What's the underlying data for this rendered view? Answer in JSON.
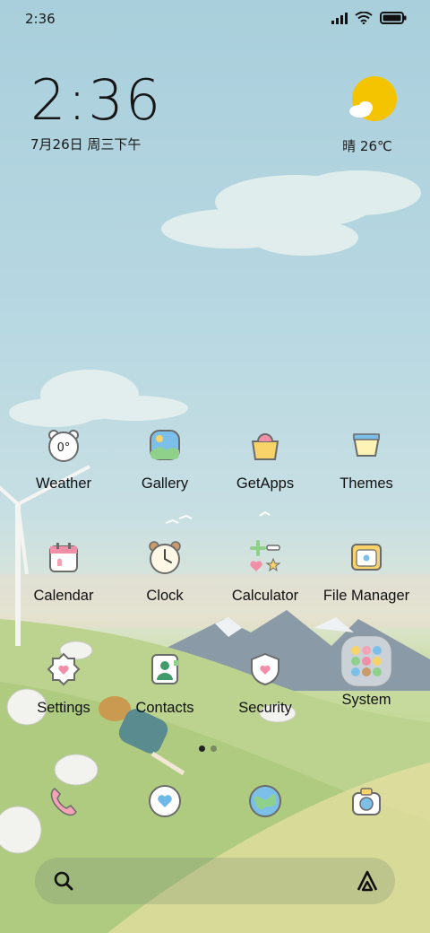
{
  "status_bar": {
    "time": "2:36",
    "icons": [
      "signal-icon",
      "wifi-icon",
      "battery-icon"
    ]
  },
  "clock_widget": {
    "time": "2:36",
    "date": "7月26日 周三下午"
  },
  "weather_widget": {
    "icon": "sunny-cloud-icon",
    "summary": "晴 26℃"
  },
  "apps": [
    {
      "label": "Weather",
      "icon": "weather-icon"
    },
    {
      "label": "Gallery",
      "icon": "gallery-icon"
    },
    {
      "label": "GetApps",
      "icon": "getapps-icon"
    },
    {
      "label": "Themes",
      "icon": "themes-icon"
    },
    {
      "label": "Calendar",
      "icon": "calendar-icon"
    },
    {
      "label": "Clock",
      "icon": "clock-icon"
    },
    {
      "label": "Calculator",
      "icon": "calculator-icon"
    },
    {
      "label": "File Manager",
      "icon": "file-manager-icon"
    },
    {
      "label": "Settings",
      "icon": "settings-icon"
    },
    {
      "label": "Contacts",
      "icon": "contacts-icon"
    },
    {
      "label": "Security",
      "icon": "security-icon"
    },
    {
      "label": "System",
      "icon": "system-folder-icon"
    }
  ],
  "weather_app_icon_text": "0°",
  "dock": [
    {
      "icon": "phone-icon"
    },
    {
      "icon": "messages-icon"
    },
    {
      "icon": "browser-icon"
    },
    {
      "icon": "camera-icon"
    }
  ],
  "page_indicator": {
    "pages": 2,
    "current": 1
  },
  "search_bar": {
    "icon_left": "search-icon",
    "icon_right": "assistant-icon"
  },
  "colors": {
    "sun": "#f5c400",
    "text": "#111111"
  }
}
